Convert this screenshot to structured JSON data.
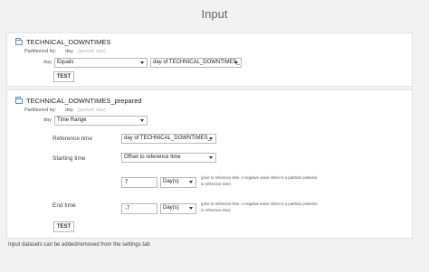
{
  "page": {
    "title": "Input"
  },
  "dataset1": {
    "name": "TECHNICAL_DOWNTIMES",
    "partitioned_label": "Partitioned by:",
    "partition_dim": "day",
    "partition_hint": "(period: day)",
    "row_dim": "day",
    "operator": "Equals",
    "value_select": "day of TECHNICAL_DOWNTIMES_",
    "test_button": "TEST"
  },
  "dataset2": {
    "name": "TECHNICAL_DOWNTIMES_prepared",
    "partitioned_label": "Partitioned by:",
    "partition_dim": "day",
    "partition_hint": "(period: day)",
    "row_dim": "day",
    "operator": "Time Range",
    "reference_time_label": "Reference time",
    "reference_time_value": "day of TECHNICAL_DOWNTIMES_",
    "starting_time_label": "Starting time",
    "starting_time_mode": "Offset to reference time",
    "start_offset": "7",
    "start_unit": "Day(s)",
    "start_help": "(prior to reference time. A negative value refers to a partition posterior to reference time)",
    "end_time_label": "End time",
    "end_offset": "-7",
    "end_unit": "Day(s)",
    "end_help": "(prior to reference time. A negative value refers to a partition posterior to reference time)",
    "test_button": "TEST"
  },
  "footer": {
    "note": "Input datasets can be added/removed from the settings tab"
  },
  "colors": {
    "background": "#f2f2f2",
    "card": "#ffffff",
    "folder_icon": "#4a8fc9",
    "border": "#b9b9b9"
  }
}
